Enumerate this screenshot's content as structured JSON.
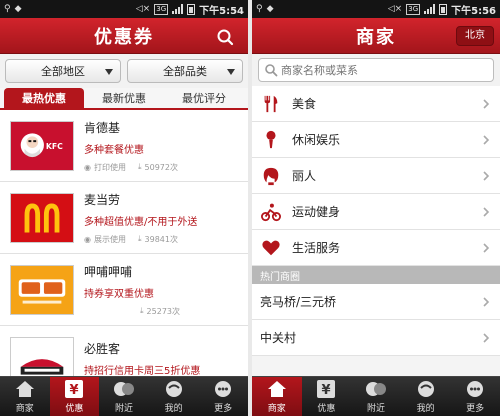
{
  "status": {
    "left_time": "下午5:54",
    "right_time": "下午5:56",
    "signal_box": "3G"
  },
  "left": {
    "title": "优惠券",
    "filters": [
      "全部地区",
      "全部品类"
    ],
    "tabs": [
      "最热优惠",
      "最新优惠",
      "最优评分"
    ],
    "items": [
      {
        "name": "肯德基",
        "promo": "多种套餐优惠",
        "action": "打印使用",
        "count": "50972次",
        "logo_text": "KFC"
      },
      {
        "name": "麦当劳",
        "promo": "多种超值优惠/不用于外送",
        "action": "展示使用",
        "count": "39841次",
        "logo_text": ""
      },
      {
        "name": "呷哺呷哺",
        "promo": "持券享双重优惠",
        "action": "",
        "count": "25273次",
        "logo_text": ""
      },
      {
        "name": "必胜客",
        "promo": "持招行信用卡周三5折优惠",
        "action": "",
        "count": "",
        "logo_text": ""
      }
    ]
  },
  "right": {
    "title": "商家",
    "city": "北京",
    "search_placeholder": "商家名称或菜系",
    "categories": [
      "美食",
      "休闲娱乐",
      "丽人",
      "运动健身",
      "生活服务"
    ],
    "section_header": "热门商圈",
    "areas": [
      "亮马桥/三元桥",
      "中关村"
    ]
  },
  "tabbar": [
    "商家",
    "优惠",
    "附近",
    "我的",
    "更多"
  ],
  "colors": {
    "brand_red": "#b3161c",
    "promo_red": "#b3161c"
  }
}
